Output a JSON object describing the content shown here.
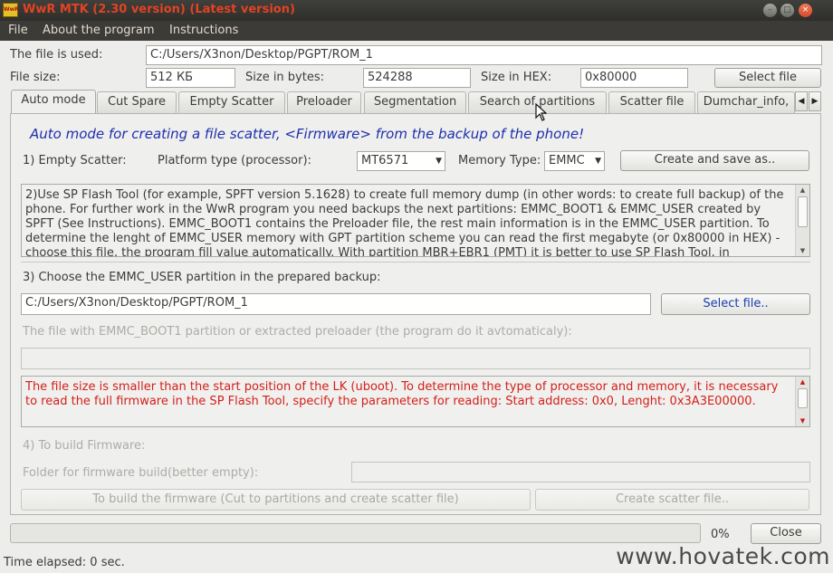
{
  "window": {
    "title": "WwR MTK (2.30 version) (Latest version)",
    "icon_text": "WwR",
    "minimize": "–",
    "maximize": "□",
    "close": "×"
  },
  "menu": [
    "File",
    "About the program",
    "Instructions"
  ],
  "file_info": {
    "used_label": "The file is used:",
    "used_value": "C:/Users/X3non/Desktop/PGPT/ROM_1",
    "size_label": "File size:",
    "size_value": "512 КБ",
    "bytes_label": "Size in bytes:",
    "bytes_value": "524288",
    "hex_label": "Size in HEX:",
    "hex_value": "0x80000",
    "select_button": "Select file"
  },
  "tabs": [
    "Auto mode",
    "Cut Spare",
    "Empty Scatter",
    "Preloader",
    "Segmentation",
    "Search of partitions",
    "Scatter file",
    "Dumchar_info,"
  ],
  "active_tab": 0,
  "tab_scroll": {
    "left": "◀",
    "right": "▶"
  },
  "auto": {
    "heading": "Auto mode for creating a file scatter, <Firmware> from the backup of the phone!",
    "step1_label": "1) Empty Scatter:",
    "platform_label": "Platform type (processor):",
    "platform_value": "MT6571",
    "memory_label": "Memory Type:",
    "memory_value": "EMMC",
    "create_button": "Create and save as..",
    "step2_text": "2)Use SP Flash Tool (for example, SPFT version 5.1628) to create full memory dump (in other words: to create full backup) of the phone. For further work in the WwR program you need backups the next partitions: EMMC_BOOT1 & EMMC_USER created by SPFT (See Instructions). EMMC_BOOT1 contains the Preloader file, the rest main information is in the EMMC_USER partition. To determine the lenght of EMMC_USER memory with GPT partition scheme you can read the first megabyte (or 0x80000 in HEX) - choose this file, the program fill value automatically. With partition MBR+EBR1 (PMT) it is better to use SP Flash Tool, in",
    "step3_label": "3) Choose the EMMC_USER partition in the prepared backup:",
    "user_path": "C:/Users/X3non/Desktop/PGPT/ROM_1",
    "select_file2": "Select file..",
    "boot1_label": "The file with EMMC_BOOT1 partition or extracted preloader (the program do it avtomaticaly):",
    "boot1_value": "",
    "error_text": "The file size is smaller than the start position of the LK (uboot). To determine the type of processor and memory, it is necessary to read the full firmware in the SP Flash Tool, specify the parameters for reading: Start address: 0x0, Lenght: 0x3A3E00000.",
    "step4_label": "4) To build Firmware:",
    "folder_label": "Folder for firmware build(better empty):",
    "folder_value": "",
    "build_button": "To build the firmware (Cut to partitions and create scatter file)",
    "scatter_button": "Create scatter file.."
  },
  "footer": {
    "progress_value": 0,
    "progress_text": "0%",
    "close_button": "Close",
    "elapsed": "Time elapsed: 0  sec."
  },
  "watermark": "www.hovatek.com"
}
